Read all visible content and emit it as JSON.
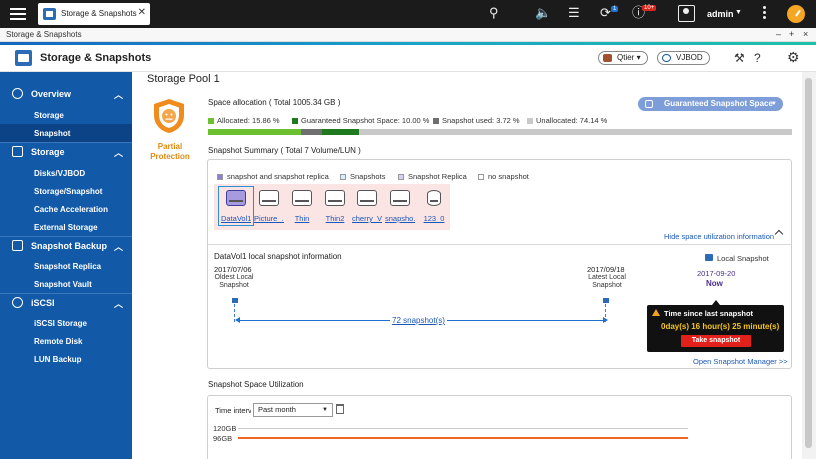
{
  "tab": {
    "label": "Storage & Snapshots"
  },
  "topbar": {
    "user": "admin",
    "notif_badge": "1",
    "alert_badge": "10+"
  },
  "window": {
    "title": "Storage & Snapshots",
    "min": "–",
    "max": "+",
    "close": "×"
  },
  "app": {
    "title": "Storage & Snapshots",
    "qtier": "Qtier",
    "vjbod": "VJBOD"
  },
  "sidebar": {
    "overview": "Overview",
    "storage_sub": "Storage",
    "snapshot_sub": "Snapshot",
    "storage": "Storage",
    "disks": "Disks/VJBOD",
    "storage_snapshot": "Storage/Snapshot",
    "cache": "Cache Acceleration",
    "external": "External Storage",
    "snapshot_backup": "Snapshot Backup",
    "replica": "Snapshot Replica",
    "vault": "Snapshot Vault",
    "iscsi": "iSCSI",
    "iscsi_storage": "iSCSI Storage",
    "remote_disk": "Remote Disk",
    "lun_backup": "LUN Backup"
  },
  "main": {
    "title": "Storage Pool 1",
    "protection": "Partial Protection",
    "space_title": "Space allocation ( Total 1005.34 GB )",
    "gss_button": "Guaranteed Snapshot Space",
    "legend": {
      "allocated": "Allocated: 15.86 %",
      "guaranteed": "Guaranteed Snapshot Space: 10.00 %",
      "used": "Snapshot used: 3.72 %",
      "unallocated": "Unallocated: 74.14 %"
    },
    "usage": {
      "allocated": 15.86,
      "guaranteed": 10.0,
      "used": 3.72
    },
    "colors": {
      "allocated": "#6cbf2f",
      "guaranteed": "#1f7a1f",
      "used": "#6f6f6f",
      "unallocated": "#c9c9c9"
    },
    "summary_title": "Snapshot Summary ( Total 7 Volume/LUN )",
    "legend2": {
      "both": "snapshot and snapshot replica",
      "snapshots": "Snapshots",
      "replica": "Snapshot Replica",
      "none": "no snapshot"
    },
    "volumes": [
      "DataVol1",
      "Picture_...",
      "Thin",
      "Thin2",
      "cherry_V...",
      "snapsho...",
      "123_0"
    ],
    "hide_link": "Hide space utilization information",
    "info_title": "DataVol1 local snapshot information",
    "local_snapshot": "Local Snapshot",
    "oldest_date": "2017/07/06",
    "oldest_lbl": "Oldest Local Snapshot",
    "latest_date": "2017/09/18",
    "latest_lbl": "Latest Local Snapshot",
    "now_date": "2017-09-20",
    "now_lbl": "Now",
    "count": "72 snapshot(s)",
    "tip": {
      "title": "Time since last snapshot",
      "value": "0day(s) 16 hour(s) 25 minute(s)",
      "button": "Take snapshot"
    },
    "open_manager": "Open Snapshot Manager >>",
    "util_title": "Snapshot Space Utilization",
    "time_label": "Time interval",
    "time_value": "Past month",
    "y_labels": [
      "120GB",
      "96GB"
    ]
  }
}
